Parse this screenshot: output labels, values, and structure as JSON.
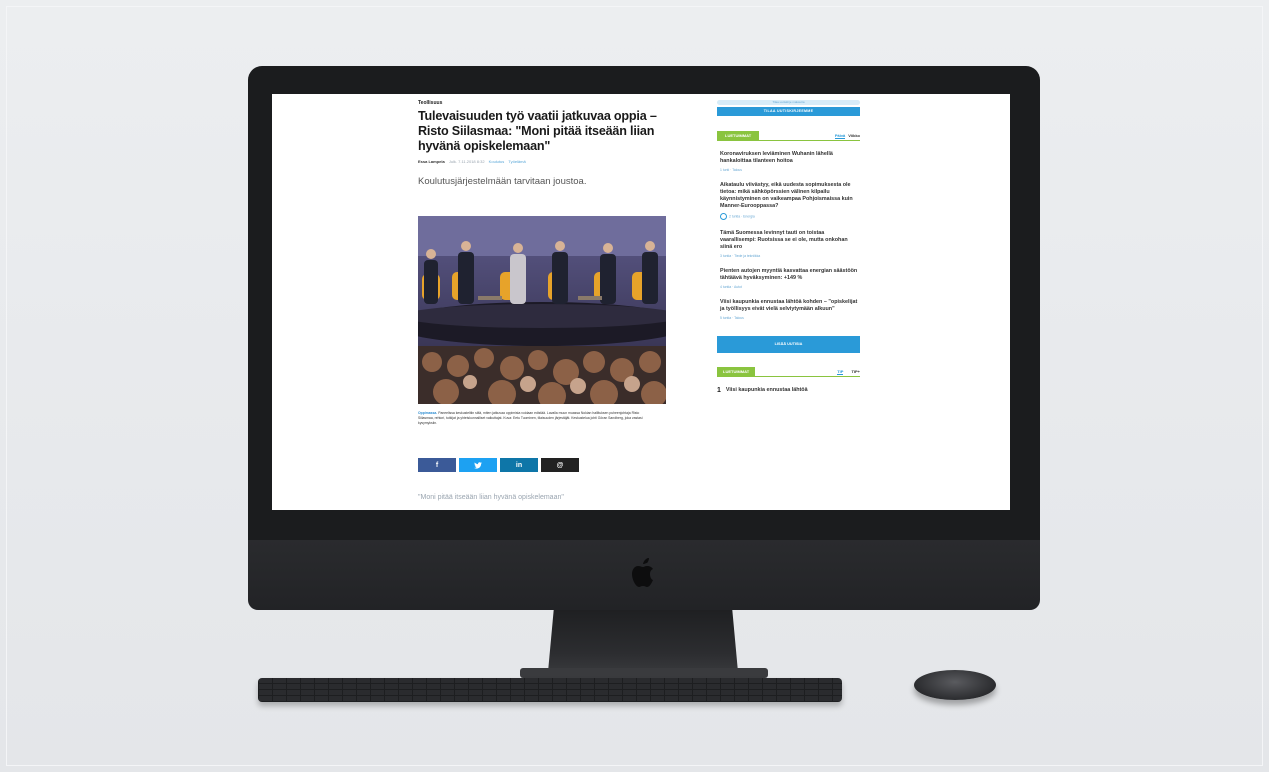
{
  "article": {
    "section": "Teollisuus",
    "headline": "Tulevaisuuden työ vaatii jatkuvaa oppia – Risto Siilasmaa: \"Moni pitää itseään liian hyvänä opiskelemaan\"",
    "author": "Essa Lampela",
    "meta": "Julk. 7.11.2018 8:32",
    "tags": [
      "Koulutus",
      "Työelämä"
    ],
    "lead": "Koulutusjärjestelmään tarvitaan joustoa.",
    "caption_lead": "Oppimassa.",
    "caption_body": "Paneelissa keskusteltiin siitä, miten jatkuvaa oppimista voidaan edistää. Lavalla muun muassa Nokian hallituksen puheenjohtaja Risto Siilasmaa, rehtori, tutkijat ja yhteiskunnalliset vaikuttajat. Kuva: Eetu Tuominen, tilaisuuden järjestäjät. Keskustelua johti Göran Sandberg, joka vastasi kysymyksiin.",
    "share": {
      "facebook": "f",
      "twitter": "t",
      "linkedin": "in",
      "email": "@"
    },
    "teaser": "\"Moni pitää itseään liian hyvänä opiskelemaan\""
  },
  "sidebar": {
    "subscribe_top": "Tilaa uutiskirje maksutta",
    "subscribe_button": "TILAA UUTISKIRJEEMME",
    "latest_label": "LUETUIMMAT",
    "latest_tabs": [
      "Päivä",
      "Viikko"
    ],
    "items": [
      {
        "title": "Koronaviruksen leviäminen Wuhanin lähellä hankaloittaa tilanteen hoitoa",
        "info": "1 tunti · Talous"
      },
      {
        "title": "Aikataulu viivästyy, eikä uudesta sopimuksesta ole tietoa: mikä sähköpörssien välinen kilpailu käynnistyminen on vaikeampaa Pohjoismaissa kuin Manner-Eurooppassa?",
        "info": "2 tuntia · Energia"
      },
      {
        "title": "Tämä Suomessa levinnyt tauti on toistaa vaarallisempi: Ruotsissa se ei ole, mutta onkohan siinä ero",
        "info": "3 tuntia · Tiede ja tekniikka"
      },
      {
        "title": "Pienten autojen myyntiä kasvattaa energian säästöön tähtäävä hyväksyminen: +149 %",
        "info": "4 tuntia · Autot"
      },
      {
        "title": "Viisi kaupunkia ennustaa lähtöä kohden – \"opiskelijat ja työllisyys eivät vielä selviytymään alkuun\"",
        "info": "5 tuntia · Talous"
      }
    ],
    "more_button": "LISÄÄ UUTISIA",
    "read_label": "LUETUIMMAT",
    "read_tabs": [
      "TIP",
      "TIP+"
    ],
    "read_items": [
      {
        "num": "1",
        "title": "Viisi kaupunkia ennustaa lähtöä"
      }
    ]
  },
  "colors": {
    "accent_blue": "#2a9ad8",
    "accent_green": "#8ac43f",
    "facebook": "#3b5a98",
    "twitter": "#1da1f2",
    "linkedin": "#0e76a8",
    "email": "#222222"
  },
  "icons": [
    "apple-logo-icon",
    "facebook-icon",
    "twitter-icon",
    "linkedin-icon",
    "email-icon"
  ]
}
